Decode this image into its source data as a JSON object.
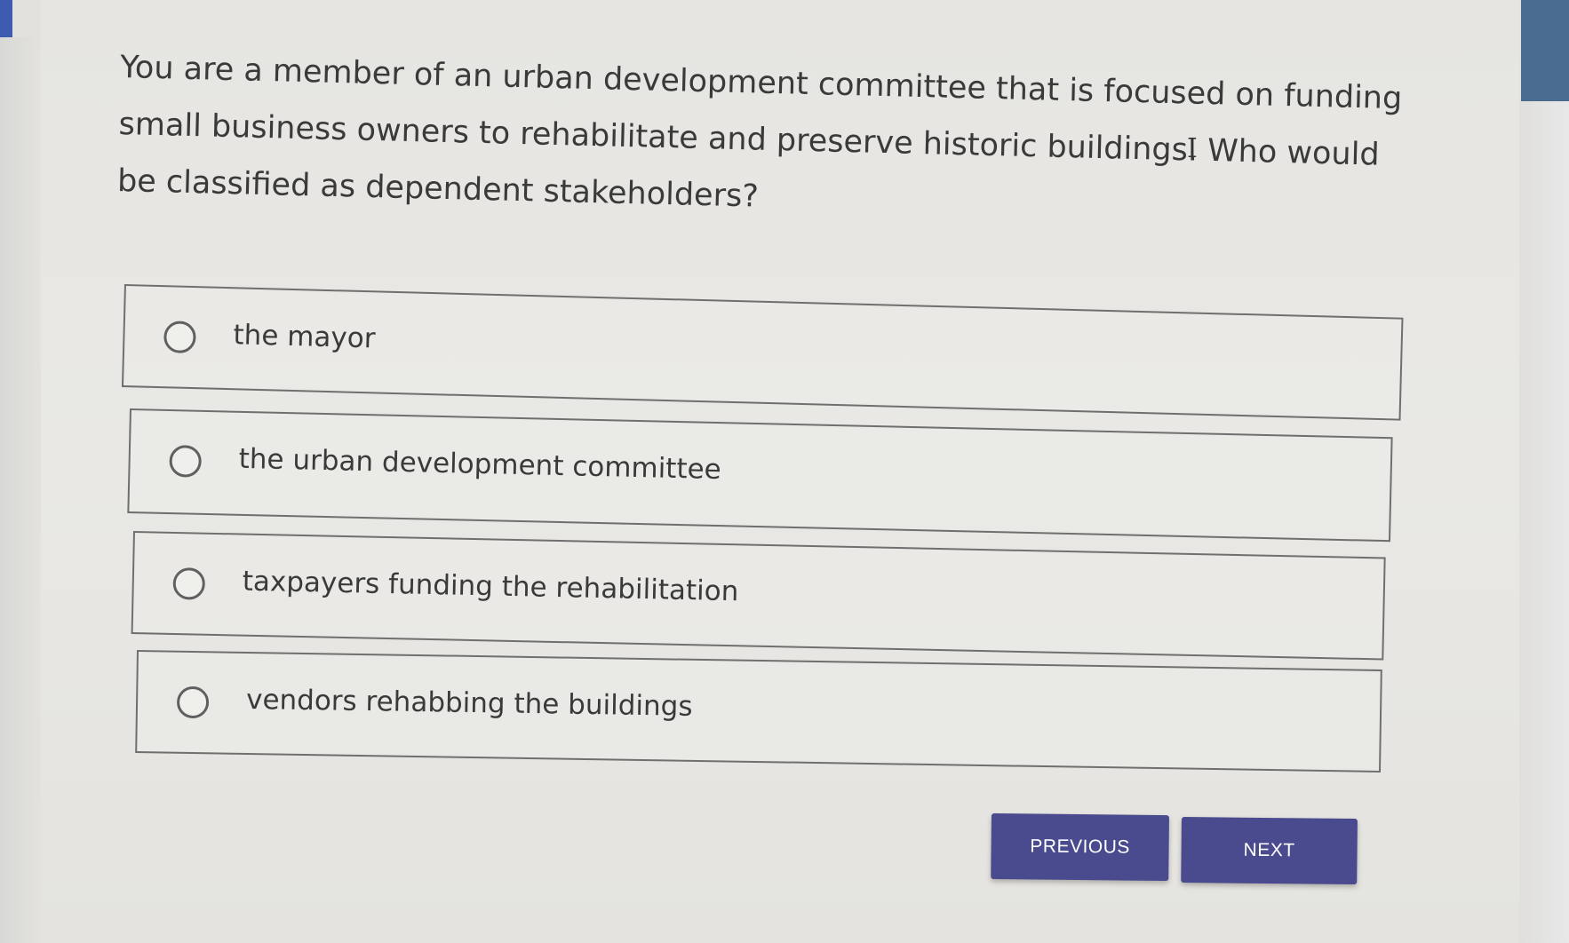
{
  "question": {
    "text": "You are a member of an urban development committee that is focused on funding small business owners to rehabilitate and preserve historic buildings. Who would be classified as dependent stakeholders?"
  },
  "options": [
    {
      "label": "the mayor",
      "selected": false
    },
    {
      "label": "the urban development committee",
      "selected": false
    },
    {
      "label": "taxpayers funding the rehabilitation",
      "selected": false
    },
    {
      "label": "vendors rehabbing the buildings",
      "selected": false
    }
  ],
  "navigation": {
    "previous_label": "PREVIOUS",
    "next_label": "NEXT"
  },
  "colors": {
    "button": "#4a4a8e",
    "accent_left": "#3e5bb0",
    "accent_right": "#4a6c91"
  }
}
